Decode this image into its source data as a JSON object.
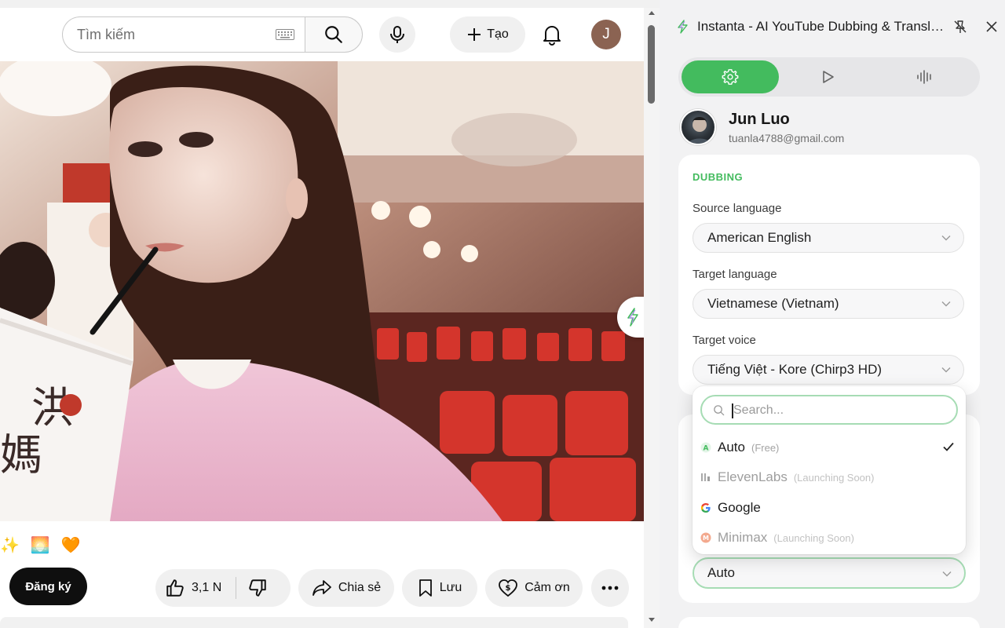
{
  "youtube": {
    "search_placeholder": "Tìm kiếm",
    "create_label": "Tạo",
    "avatar_letter": "J",
    "emojis": [
      "✨",
      "🌅",
      "🧡"
    ],
    "subscribe_label": "Đăng ký",
    "like_count": "3,1 N",
    "share_label": "Chia sẻ",
    "save_label": "Lưu",
    "thanks_label": "Cảm ơn"
  },
  "extension": {
    "title": "Instanta - AI YouTube Dubbing & Translator",
    "accent_color": "#43bb5e",
    "tabs": [
      {
        "icon": "gear-icon",
        "active": true
      },
      {
        "icon": "play-icon",
        "active": false
      },
      {
        "icon": "waveform-icon",
        "active": false
      }
    ],
    "user": {
      "name": "Jun Luo",
      "email": "tuanla4788@gmail.com"
    },
    "dubbing": {
      "section_title": "DUBBING",
      "source_label": "Source language",
      "source_value": "American English",
      "target_label": "Target language",
      "target_value": "Vietnamese (Vietnam)",
      "voice_label": "Target voice",
      "voice_value": "Tiếng Việt - Kore (Chirp3 HD)"
    },
    "provider_dropdown": {
      "search_placeholder": "Search...",
      "options": [
        {
          "name": "Auto",
          "tag": "(Free)",
          "selected": true
        },
        {
          "name": "ElevenLabs",
          "tag": "(Launching Soon)",
          "selected": false
        },
        {
          "name": "Google",
          "tag": "",
          "selected": false
        },
        {
          "name": "Minimax",
          "tag": "(Launching Soon)",
          "selected": false
        }
      ],
      "current_value": "Auto"
    }
  }
}
